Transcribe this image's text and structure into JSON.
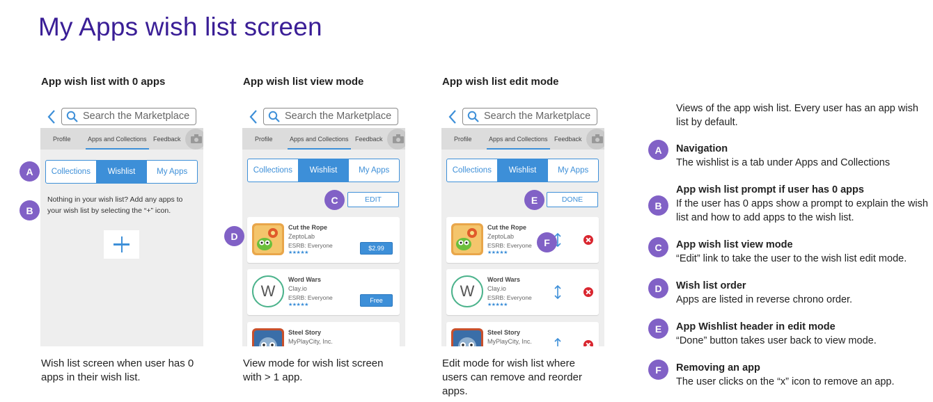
{
  "page_title": "My Apps wish list screen",
  "search": {
    "placeholder": "Search the Marketplace"
  },
  "tabs": {
    "profile": "Profile",
    "apps": "Apps and Collections",
    "feedback": "Feedback"
  },
  "segments": {
    "collections": "Collections",
    "wishlist": "Wishlist",
    "myapps": "My Apps"
  },
  "col1": {
    "heading": "App wish list with 0 apps",
    "empty_message": "Nothing in your wish list? Add any apps to your wish list by selecting the “+” icon.",
    "caption": "Wish list screen when user has 0 apps  in their wish list."
  },
  "col2": {
    "heading": "App wish list view mode",
    "edit_label": "EDIT",
    "caption": "View mode for wish list screen with > 1 app."
  },
  "col3": {
    "heading": "App wish list edit mode",
    "done_label": "DONE",
    "caption": "Edit mode for wish list where users can remove and reorder apps."
  },
  "apps": [
    {
      "name": "Cut the Rope",
      "developer": "ZeptoLab",
      "esrb": "ESRB: Everyone",
      "stars": "★★★★★",
      "price": "$2.99"
    },
    {
      "name": "Word Wars",
      "developer": "Clay.io",
      "esrb": "ESRB: Everyone",
      "stars": "★★★★★",
      "price": "Free",
      "icon_letter": "W"
    },
    {
      "name": "Steel Story",
      "developer": "MyPlayCity, Inc."
    }
  ],
  "markers": [
    "A",
    "B",
    "C",
    "D",
    "E",
    "F"
  ],
  "legend": {
    "intro": "Views of the app wish list. Every user has an app wish list by default.",
    "items": [
      {
        "letter": "A",
        "title": "Navigation",
        "desc": "The wishlist is a tab under Apps and Collections"
      },
      {
        "letter": "B",
        "title": "App wish list prompt if user has 0 apps",
        "desc": "If the user has 0 apps show a prompt to explain the wish list and how to add apps to the wish list."
      },
      {
        "letter": "C",
        "title": "App  wish list view mode",
        "desc": "“Edit” link to take the user to the wish list edit mode."
      },
      {
        "letter": "D",
        "title": "Wish list order",
        "desc": "Apps are listed in reverse chrono order."
      },
      {
        "letter": "E",
        "title": "App Wishlist header in edit mode",
        "desc": "“Done” button takes user back to view mode."
      },
      {
        "letter": "F",
        "title": "Removing an app",
        "desc": "The user clicks on the “x” icon to remove an app."
      }
    ]
  },
  "colors": {
    "title": "#3a1e96",
    "accent": "#3d8fd8",
    "marker": "#8161c6",
    "remove": "#d9262f"
  },
  "icons": [
    "back-chevron-icon",
    "search-icon",
    "camera-icon",
    "plus-icon",
    "reorder-icon",
    "remove-icon"
  ]
}
